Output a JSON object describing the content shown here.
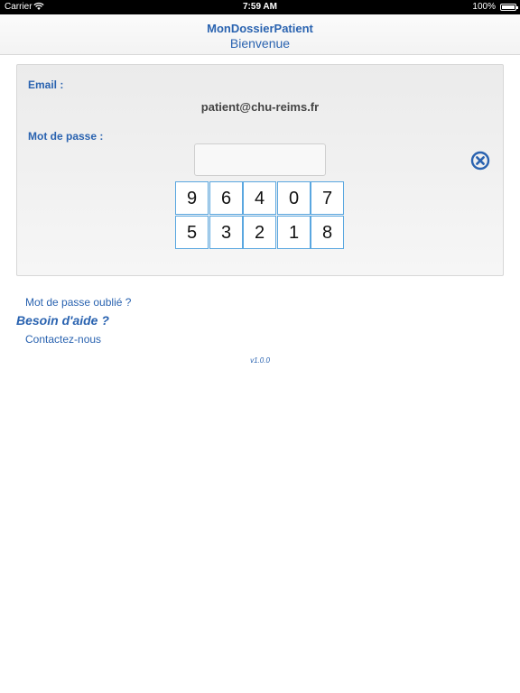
{
  "status_bar": {
    "carrier": "Carrier",
    "time": "7:59 AM",
    "battery": "100%"
  },
  "header": {
    "title": "MonDossierPatient",
    "subtitle": "Bienvenue"
  },
  "login": {
    "email_label": "Email :",
    "email_value": "patient@chu-reims.fr",
    "password_label": "Mot de passe :",
    "password_value": "",
    "clear_icon": "circle-x-icon"
  },
  "keypad": {
    "rows": [
      [
        "9",
        "6",
        "4",
        "0",
        "7"
      ],
      [
        "5",
        "3",
        "2",
        "1",
        "8"
      ]
    ]
  },
  "links": {
    "forgot_password": "Mot de passe oublié ?",
    "help_heading": "Besoin d'aide ?",
    "contact": "Contactez-nous"
  },
  "footer": {
    "version": "v1.0.0"
  },
  "colors": {
    "accent": "#2a63b0",
    "key_border": "#5aa7e0"
  }
}
